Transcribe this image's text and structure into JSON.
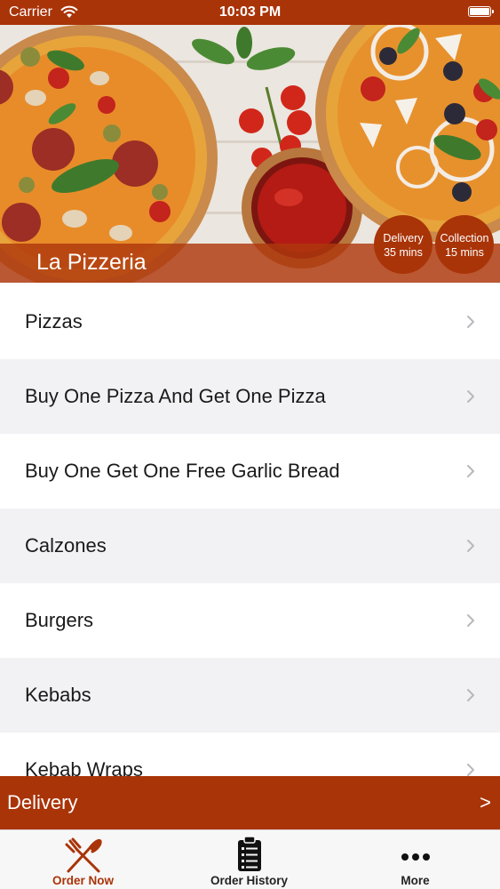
{
  "status_bar": {
    "carrier": "Carrier",
    "time": "10:03 PM",
    "icons": [
      "wifi-icon",
      "battery-icon"
    ]
  },
  "hero": {
    "restaurant_name": "La Pizzeria",
    "delivery_badge": {
      "label": "Delivery",
      "time": "35 mins"
    },
    "collection_badge": {
      "label": "Collection",
      "time": "15 mins"
    }
  },
  "categories": [
    {
      "label": "Pizzas"
    },
    {
      "label": "Buy One Pizza And Get One Pizza"
    },
    {
      "label": "Buy One Get One Free Garlic Bread"
    },
    {
      "label": "Calzones"
    },
    {
      "label": "Burgers"
    },
    {
      "label": "Kebabs"
    },
    {
      "label": "Kebab Wraps"
    }
  ],
  "delivery_bar": {
    "label": "Delivery",
    "arrow": ">"
  },
  "tab_bar": {
    "tabs": [
      {
        "label": "Order Now",
        "icon": "fork-knife-icon",
        "active": true
      },
      {
        "label": "Order History",
        "icon": "clipboard-list-icon",
        "active": false
      },
      {
        "label": "More",
        "icon": "more-dots-icon",
        "active": false
      }
    ]
  },
  "colors": {
    "brand": "#a93408",
    "row_alt": "#f2f2f4",
    "tab_bar_bg": "#f7f7f7"
  }
}
